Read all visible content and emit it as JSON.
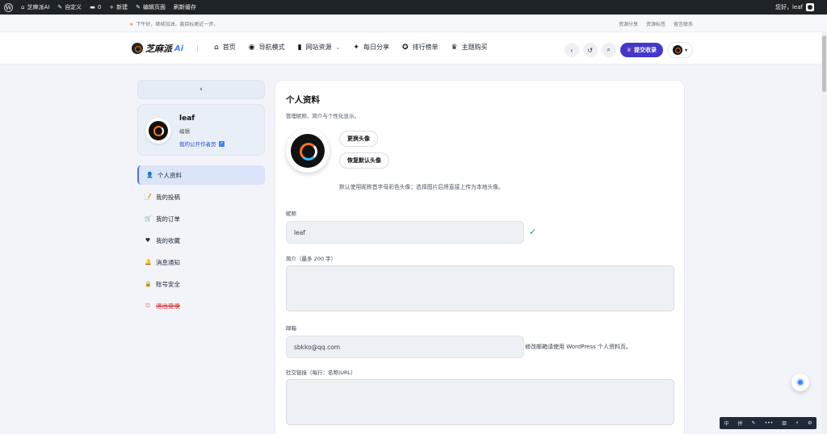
{
  "admin_bar": {
    "wp_logo": "W",
    "site_name": "芝麻派AI",
    "customize": "自定义",
    "comments_count": "0",
    "new": "新建",
    "edit_page": "编辑页面",
    "clear_cache": "刷新缓存",
    "greeting": "您好，leaf"
  },
  "notice": {
    "message": "下午好，继续加油，离目标更近一步。",
    "links": [
      "资源分享",
      "资源标签",
      "留言联系"
    ]
  },
  "header": {
    "logo_text": "芝麻派",
    "logo_ai": "Ai",
    "nav": [
      {
        "icon": "home-icon",
        "glyph": "⌂",
        "label": "首页"
      },
      {
        "icon": "compass-icon",
        "glyph": "◉",
        "label": "导航模式"
      },
      {
        "icon": "bar-chart-icon",
        "glyph": "▮",
        "label": "网站资源"
      },
      {
        "icon": "magic-wand-icon",
        "glyph": "✦",
        "label": "每日分享"
      },
      {
        "icon": "award-icon",
        "glyph": "✪",
        "label": "排行榜单"
      },
      {
        "icon": "crown-icon",
        "glyph": "♛",
        "label": "主题购买"
      }
    ],
    "submit_label": "提交收录"
  },
  "sidebar": {
    "user_name": "leaf",
    "user_role": "编辑",
    "public_page": "我的公开作者页",
    "menu": [
      {
        "icon": "user-icon",
        "glyph": "👤",
        "label": "个人资料",
        "active": true
      },
      {
        "icon": "post-icon",
        "glyph": "📝",
        "label": "我的投稿"
      },
      {
        "icon": "cart-icon",
        "glyph": "🛒",
        "label": "我的订单"
      },
      {
        "icon": "heart-icon",
        "glyph": "♥",
        "label": "我的收藏"
      },
      {
        "icon": "bell-icon",
        "glyph": "🔔",
        "label": "消息通知"
      },
      {
        "icon": "lock-icon",
        "glyph": "🔒",
        "label": "账号安全"
      },
      {
        "icon": "logout-icon",
        "glyph": "⎋",
        "label": "退出登录"
      }
    ]
  },
  "profile": {
    "title": "个人资料",
    "subtitle": "管理昵称、简介与个性化显示。",
    "change_avatar": "更换头像",
    "reset_avatar": "恢复默认头像",
    "avatar_hint": "默认使用昵称首字母彩色头像；选择图片后将直接上传为本地头像。",
    "nickname_label": "昵称",
    "nickname_value": "leaf",
    "bio_label": "简介（最多 200 字）",
    "email_label": "邮箱",
    "email_value": "sbkko@qq.com",
    "email_note": "修改邮箱请使用 WordPress 个人资料页。",
    "social_label": "社交链接（每行：名称|URL）"
  },
  "tray": {
    "items": [
      "中",
      "拼",
      "✎",
      "•••",
      "▥",
      "⚡",
      "⚙"
    ]
  }
}
